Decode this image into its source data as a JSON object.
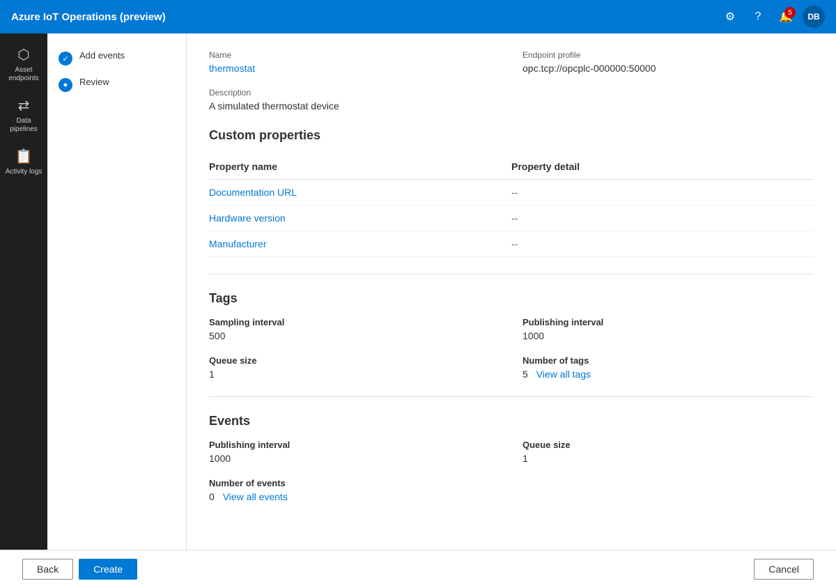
{
  "app": {
    "title": "Azure IoT Operations (preview)"
  },
  "topbar": {
    "title": "Azure IoT Operations (preview)",
    "notifications_count": "5",
    "avatar_initials": "DB"
  },
  "sidebar": {
    "items": [
      {
        "id": "asset-endpoints",
        "label": "Asset endpoints",
        "icon": "⬡"
      },
      {
        "id": "data-pipelines",
        "label": "Data pipelines",
        "icon": "⇄"
      },
      {
        "id": "activity-logs",
        "label": "Activity logs",
        "icon": "📋"
      }
    ]
  },
  "wizard": {
    "steps": [
      {
        "id": "add-events",
        "label": "Add events",
        "status": "completed",
        "indicator": "✓"
      },
      {
        "id": "review",
        "label": "Review",
        "status": "active",
        "indicator": "●"
      }
    ]
  },
  "asset": {
    "name_label": "Name",
    "name_value": "thermostat",
    "endpoint_label": "Endpoint profile",
    "endpoint_value": "opc.tcp://opcplc-000000:50000",
    "description_label": "Description",
    "description_value": "A simulated thermostat device"
  },
  "custom_properties": {
    "section_title": "Custom properties",
    "columns": {
      "property_name": "Property name",
      "property_detail": "Property detail"
    },
    "rows": [
      {
        "name": "Documentation URL",
        "detail": "--"
      },
      {
        "name": "Hardware version",
        "detail": "--"
      },
      {
        "name": "Manufacturer",
        "detail": "--"
      }
    ]
  },
  "tags": {
    "section_title": "Tags",
    "sampling_interval_label": "Sampling interval",
    "sampling_interval_value": "500",
    "publishing_interval_label": "Publishing interval",
    "publishing_interval_value": "1000",
    "queue_size_label": "Queue size",
    "queue_size_value": "1",
    "number_of_tags_label": "Number of tags",
    "number_of_tags_count": "5",
    "view_all_tags_label": "View all tags"
  },
  "events": {
    "section_title": "Events",
    "publishing_interval_label": "Publishing interval",
    "publishing_interval_value": "1000",
    "queue_size_label": "Queue size",
    "queue_size_value": "1",
    "number_of_events_label": "Number of events",
    "number_of_events_count": "0",
    "view_all_events_label": "View all events"
  },
  "footer": {
    "back_label": "Back",
    "create_label": "Create",
    "cancel_label": "Cancel"
  }
}
